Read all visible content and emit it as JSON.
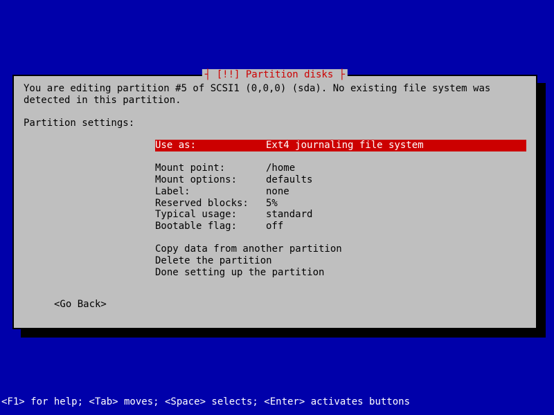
{
  "dialog": {
    "title": "[!!] Partition disks",
    "intro": "You are editing partition #5 of SCSI1 (0,0,0) (sda). No existing file system was detected in this partition.",
    "subtitle": "Partition settings:",
    "settings": [
      {
        "label": "Use as:",
        "value": "Ext4 journaling file system",
        "selected": true
      },
      {
        "label": "Mount point:",
        "value": "/home",
        "selected": false
      },
      {
        "label": "Mount options:",
        "value": "defaults",
        "selected": false
      },
      {
        "label": "Label:",
        "value": "none",
        "selected": false
      },
      {
        "label": "Reserved blocks:",
        "value": "5%",
        "selected": false
      },
      {
        "label": "Typical usage:",
        "value": "standard",
        "selected": false
      },
      {
        "label": "Bootable flag:",
        "value": "off",
        "selected": false
      }
    ],
    "actions": [
      "Copy data from another partition",
      "Delete the partition",
      "Done setting up the partition"
    ],
    "go_back": "<Go Back>"
  },
  "help_bar": "<F1> for help; <Tab> moves; <Space> selects; <Enter> activates buttons"
}
